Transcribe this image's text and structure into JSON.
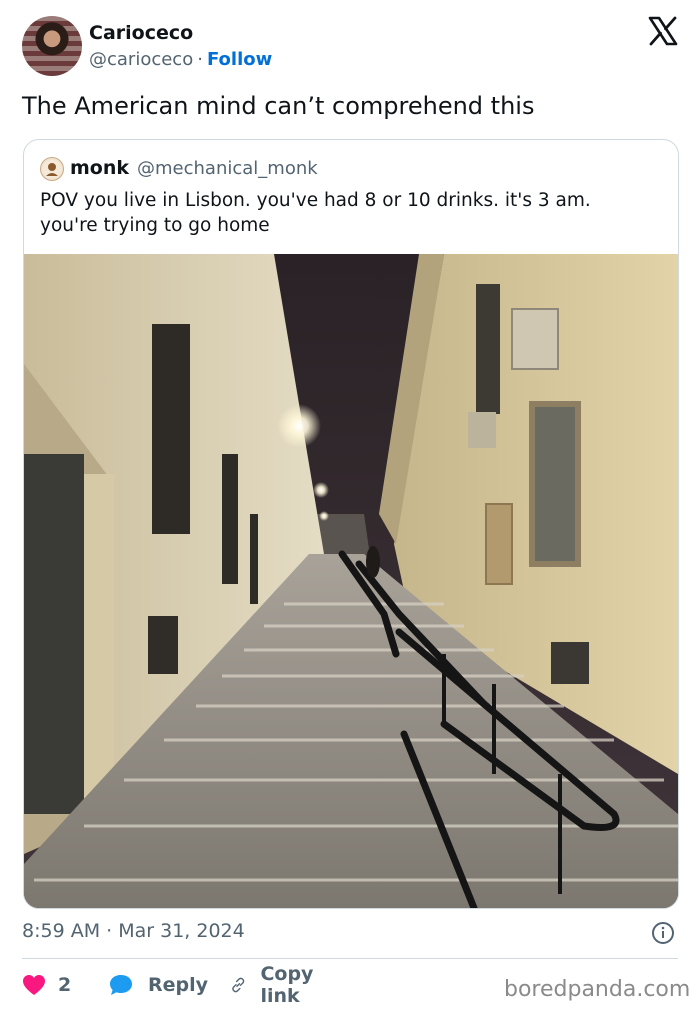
{
  "author": {
    "name": "Carioceco",
    "handle": "@carioceco",
    "separator": "·",
    "follow_label": "Follow"
  },
  "tweet": {
    "text": "The American mind can’t comprehend this"
  },
  "quoted": {
    "name": "monk",
    "handle": "@mechanical_monk",
    "text": "POV you live in Lisbon. you've had 8 or 10 drinks. it's 3 am. you're trying to go home"
  },
  "meta": {
    "timestamp": "8:59 AM · Mar 31, 2024"
  },
  "actions": {
    "like_count": "2",
    "reply_label": "Reply",
    "copy_label": "Copy link"
  },
  "watermark": "boredpanda.com",
  "colors": {
    "like": "#f91880",
    "reply": "#1d9bf0",
    "follow": "#006fd6",
    "muted": "#536471"
  },
  "icons": [
    "x-logo-icon",
    "info-icon",
    "heart-icon",
    "reply-bubble-icon",
    "link-icon"
  ]
}
